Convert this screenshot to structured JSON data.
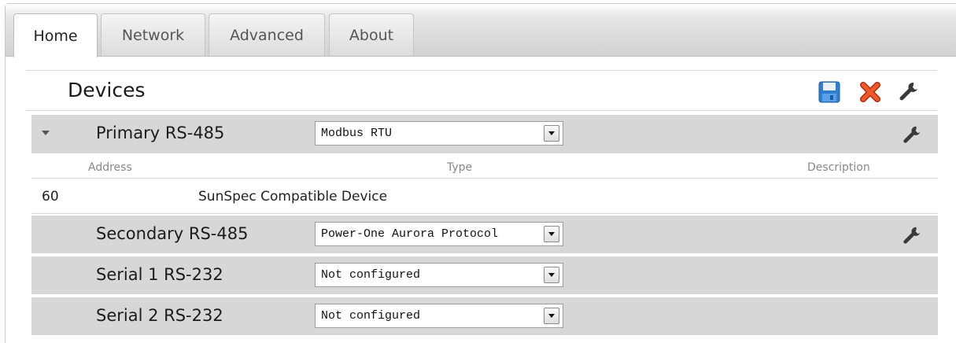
{
  "tabs": [
    {
      "label": "Home",
      "active": true
    },
    {
      "label": "Network",
      "active": false
    },
    {
      "label": "Advanced",
      "active": false
    },
    {
      "label": "About",
      "active": false
    }
  ],
  "devices": {
    "title": "Devices",
    "toolbar_icons": [
      "save-icon",
      "close-icon",
      "wrench-icon"
    ],
    "colors": {
      "save": "#2f7fd1",
      "close": "#e2401c",
      "wrench": "#3a3a3a"
    }
  },
  "ports": [
    {
      "name": "Primary RS-485",
      "protocol": "Modbus RTU",
      "expanded": true
    },
    {
      "name": "Secondary RS-485",
      "protocol": "Power-One Aurora Protocol"
    },
    {
      "name": "Serial 1 RS-232",
      "protocol": "Not configured"
    },
    {
      "name": "Serial 2 RS-232",
      "protocol": "Not configured"
    }
  ],
  "device_table": {
    "headers": {
      "address": "Address",
      "type": "Type",
      "description": "Description"
    },
    "rows": [
      {
        "address": "60",
        "type": "SunSpec Compatible Device",
        "description": ""
      }
    ]
  }
}
